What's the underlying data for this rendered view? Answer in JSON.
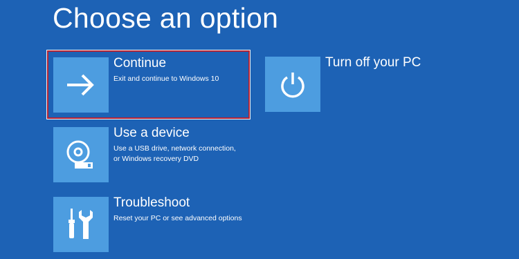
{
  "page": {
    "title": "Choose an option",
    "background": "#1d62b5",
    "tile_color": "#4d9de0",
    "highlight_color": "#b52234"
  },
  "options": [
    {
      "name": "Continue",
      "description_lines": [
        "Exit and continue to Windows 10"
      ],
      "icon": "arrow-right-icon",
      "highlighted": true
    },
    {
      "name": "Use a device",
      "description_lines": [
        "Use a USB drive, network connection,",
        "or Windows recovery DVD"
      ],
      "icon": "disc-drive-icon",
      "highlighted": false
    },
    {
      "name": "Troubleshoot",
      "description_lines": [
        "Reset your PC or see advanced options"
      ],
      "icon": "tools-icon",
      "highlighted": false
    },
    {
      "name": "Turn off your PC",
      "description_lines": [],
      "icon": "power-icon",
      "highlighted": false
    }
  ]
}
